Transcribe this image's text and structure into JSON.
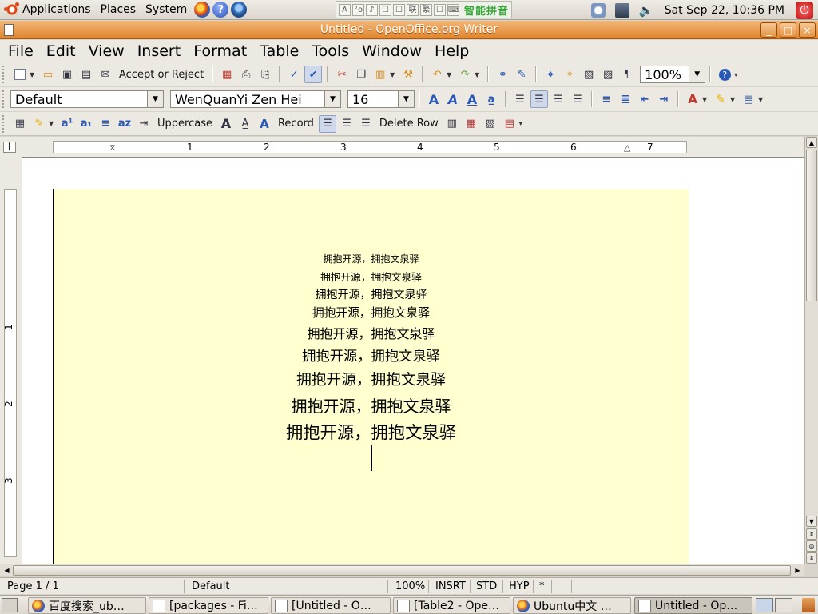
{
  "top_panel": {
    "menus": [
      "Applications",
      "Places",
      "System"
    ],
    "ime_items": [
      "A",
      "°o",
      "♪",
      "☐",
      "☐",
      "联",
      "繁",
      "☐",
      "⌨"
    ],
    "ime_label": "智能拼音",
    "clock": "Sat Sep 22, 10:36 PM"
  },
  "window": {
    "title": "Untitled - OpenOffice.org Writer",
    "buttons": [
      "_",
      "□",
      "×"
    ]
  },
  "menubar": [
    "File",
    "Edit",
    "View",
    "Insert",
    "Format",
    "Table",
    "Tools",
    "Window",
    "Help"
  ],
  "std_toolbar": {
    "accept_reject": "Accept or Reject",
    "zoom": "100%"
  },
  "fmt_toolbar": {
    "style": "Default",
    "font": "WenQuanYi Zen Hei",
    "size": "16"
  },
  "tbl_toolbar": {
    "uppercase": "Uppercase",
    "record": "Record",
    "delete_row": "Delete Row"
  },
  "ruler": {
    "numbers": [
      "1",
      "2",
      "3",
      "4",
      "5",
      "6",
      "7"
    ],
    "vnumbers": [
      "1",
      "2",
      "3"
    ]
  },
  "document": {
    "lines": [
      {
        "text": "拥抱开源，拥抱文泉驿",
        "size_pt": 9
      },
      {
        "text": "拥抱开源，拥抱文泉驿",
        "size_pt": 9.5
      },
      {
        "text": "拥抱开源，拥抱文泉驿",
        "size_pt": 10.5
      },
      {
        "text": "拥抱开源，拥抱文泉驿",
        "size_pt": 11
      },
      {
        "text": "拥抱开源，拥抱文泉驿",
        "size_pt": 12
      },
      {
        "text": "拥抱开源，拥抱文泉驿",
        "size_pt": 13
      },
      {
        "text": "拥抱开源，拥抱文泉驿",
        "size_pt": 14
      },
      {
        "text": "拥抱开源，拥抱文泉驿",
        "size_pt": 15
      },
      {
        "text": "拥抱开源，拥抱文泉驿",
        "size_pt": 16
      }
    ]
  },
  "statusbar": {
    "page": "Page 1 / 1",
    "style": "Default",
    "zoom": "100%",
    "insert_mode": "INSRT",
    "selection_mode": "STD",
    "hyperlink_mode": "HYP",
    "modified": "*"
  },
  "taskbar": [
    "百度搜索_ub…",
    "[packages - Fi…",
    "[Untitled - O…",
    "[Table2 - Ope…",
    "Ubuntu中文 …",
    "Untitled - Op…"
  ]
}
